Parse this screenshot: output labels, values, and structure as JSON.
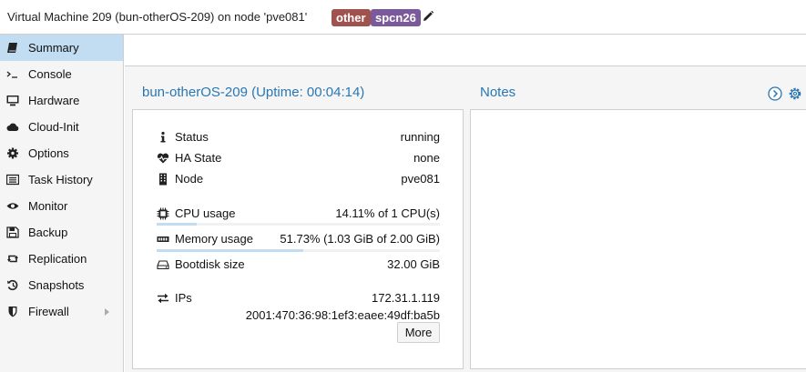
{
  "header": {
    "title": "Virtual Machine 209 (bun-otherOS-209) on node 'pve081'",
    "tags": [
      {
        "label": "other",
        "color": "#a0524f"
      },
      {
        "label": "spcn26",
        "color": "#7b5a9b"
      }
    ],
    "edit_icon": "pencil-icon"
  },
  "sidebar": {
    "items": [
      {
        "label": "Summary",
        "icon": "book-icon",
        "active": true
      },
      {
        "label": "Console",
        "icon": "terminal-icon"
      },
      {
        "label": "Hardware",
        "icon": "monitor-icon"
      },
      {
        "label": "Cloud-Init",
        "icon": "cloud-icon"
      },
      {
        "label": "Options",
        "icon": "gear-icon"
      },
      {
        "label": "Task History",
        "icon": "list-icon"
      },
      {
        "label": "Monitor",
        "icon": "eye-icon"
      },
      {
        "label": "Backup",
        "icon": "floppy-icon"
      },
      {
        "label": "Replication",
        "icon": "retweet-icon"
      },
      {
        "label": "Snapshots",
        "icon": "history-icon"
      },
      {
        "label": "Firewall",
        "icon": "shield-icon",
        "has_submenu": true
      }
    ]
  },
  "status": {
    "title": "bun-otherOS-209 (Uptime: 00:04:14)",
    "rows": {
      "status": {
        "label": "Status",
        "value": "running"
      },
      "ha": {
        "label": "HA State",
        "value": "none"
      },
      "node": {
        "label": "Node",
        "value": "pve081"
      },
      "cpu": {
        "label": "CPU usage",
        "value": "14.11% of 1 CPU(s)",
        "fraction": 0.1411
      },
      "memory": {
        "label": "Memory usage",
        "value": "51.73% (1.03 GiB of 2.00 GiB)",
        "fraction": 0.5173
      },
      "bootdisk": {
        "label": "Bootdisk size",
        "value": "32.00 GiB"
      },
      "ips": {
        "label": "IPs",
        "ipv4": "172.31.1.119",
        "ipv6": "2001:470:36:98:1ef3:eaee:49df:ba5b"
      }
    },
    "more_button": "More"
  },
  "notes": {
    "title": "Notes"
  },
  "colors": {
    "accent": "#2977b3",
    "selected": "#c2dcf2"
  }
}
